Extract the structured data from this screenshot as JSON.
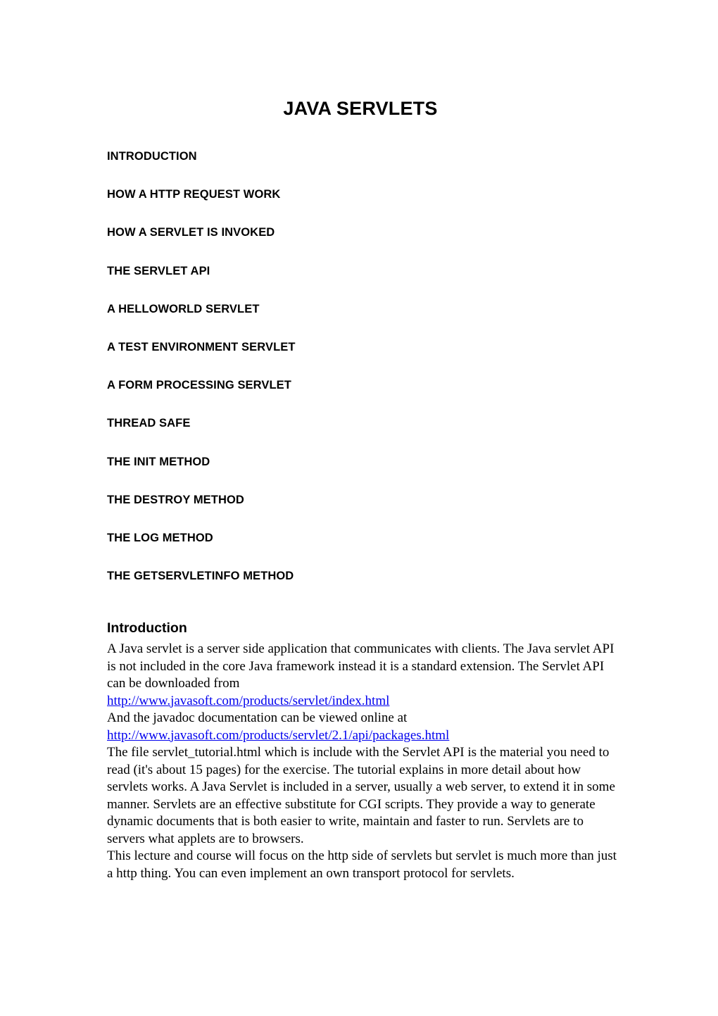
{
  "document": {
    "title": "JAVA SERVLETS"
  },
  "toc": {
    "items": [
      {
        "label": "INTRODUCTION"
      },
      {
        "label": "HOW A HTTP REQUEST WORK"
      },
      {
        "label": "HOW A SERVLET IS INVOKED"
      },
      {
        "label": "THE SERVLET API"
      },
      {
        "label": "A HELLOWORLD SERVLET"
      },
      {
        "label": "A TEST ENVIRONMENT SERVLET"
      },
      {
        "label": "A FORM PROCESSING SERVLET"
      },
      {
        "label": "THREAD SAFE"
      },
      {
        "label": "THE INIT METHOD"
      },
      {
        "label": "THE DESTROY METHOD"
      },
      {
        "label": "THE LOG METHOD"
      },
      {
        "label": "THE GETSERVLETINFO METHOD"
      }
    ]
  },
  "introduction": {
    "heading": "Introduction",
    "paragraph_1": "A Java servlet is a server side application that communicates with clients. The Java servlet API is not included in the core Java framework instead it is a standard extension. The Servlet API can be downloaded from ",
    "link_1": "http://www.javasoft.com/products/servlet/index.html",
    "paragraph_2": "And the javadoc documentation can be viewed online at ",
    "link_2": "http://www.javasoft.com/products/servlet/2.1/api/packages.html",
    "paragraph_3": "The file servlet_tutorial.html which is include with the Servlet API is the material you need to read (it's about 15 pages) for the exercise. The tutorial explains in more detail about how servlets works. A Java Servlet is included in a server, usually a web server, to extend it in some manner. Servlets are an effective substitute for CGI scripts. They provide a way to generate dynamic documents that is both easier to write, maintain and faster to run. Servlets are to servers what applets are to browsers.",
    "paragraph_4": "This lecture and course will focus on the http side of servlets but servlet is much more than just a http thing. You can even implement an own transport protocol for servlets."
  },
  "colors": {
    "page_background": "#ffffff",
    "text": "#000000",
    "link": "#0000EE"
  }
}
